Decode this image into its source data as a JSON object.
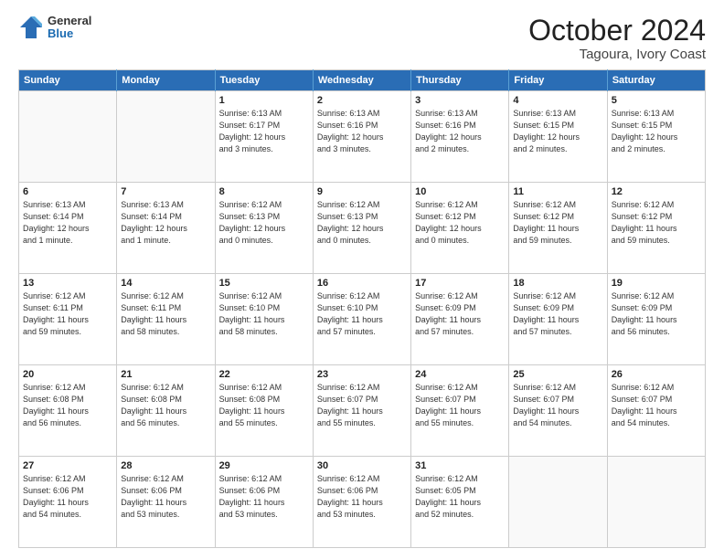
{
  "logo": {
    "line1": "General",
    "line2": "Blue"
  },
  "title": "October 2024",
  "subtitle": "Tagoura, Ivory Coast",
  "weekdays": [
    "Sunday",
    "Monday",
    "Tuesday",
    "Wednesday",
    "Thursday",
    "Friday",
    "Saturday"
  ],
  "weeks": [
    [
      {
        "day": "",
        "info": ""
      },
      {
        "day": "",
        "info": ""
      },
      {
        "day": "1",
        "info": "Sunrise: 6:13 AM\nSunset: 6:17 PM\nDaylight: 12 hours\nand 3 minutes."
      },
      {
        "day": "2",
        "info": "Sunrise: 6:13 AM\nSunset: 6:16 PM\nDaylight: 12 hours\nand 3 minutes."
      },
      {
        "day": "3",
        "info": "Sunrise: 6:13 AM\nSunset: 6:16 PM\nDaylight: 12 hours\nand 2 minutes."
      },
      {
        "day": "4",
        "info": "Sunrise: 6:13 AM\nSunset: 6:15 PM\nDaylight: 12 hours\nand 2 minutes."
      },
      {
        "day": "5",
        "info": "Sunrise: 6:13 AM\nSunset: 6:15 PM\nDaylight: 12 hours\nand 2 minutes."
      }
    ],
    [
      {
        "day": "6",
        "info": "Sunrise: 6:13 AM\nSunset: 6:14 PM\nDaylight: 12 hours\nand 1 minute."
      },
      {
        "day": "7",
        "info": "Sunrise: 6:13 AM\nSunset: 6:14 PM\nDaylight: 12 hours\nand 1 minute."
      },
      {
        "day": "8",
        "info": "Sunrise: 6:12 AM\nSunset: 6:13 PM\nDaylight: 12 hours\nand 0 minutes."
      },
      {
        "day": "9",
        "info": "Sunrise: 6:12 AM\nSunset: 6:13 PM\nDaylight: 12 hours\nand 0 minutes."
      },
      {
        "day": "10",
        "info": "Sunrise: 6:12 AM\nSunset: 6:12 PM\nDaylight: 12 hours\nand 0 minutes."
      },
      {
        "day": "11",
        "info": "Sunrise: 6:12 AM\nSunset: 6:12 PM\nDaylight: 11 hours\nand 59 minutes."
      },
      {
        "day": "12",
        "info": "Sunrise: 6:12 AM\nSunset: 6:12 PM\nDaylight: 11 hours\nand 59 minutes."
      }
    ],
    [
      {
        "day": "13",
        "info": "Sunrise: 6:12 AM\nSunset: 6:11 PM\nDaylight: 11 hours\nand 59 minutes."
      },
      {
        "day": "14",
        "info": "Sunrise: 6:12 AM\nSunset: 6:11 PM\nDaylight: 11 hours\nand 58 minutes."
      },
      {
        "day": "15",
        "info": "Sunrise: 6:12 AM\nSunset: 6:10 PM\nDaylight: 11 hours\nand 58 minutes."
      },
      {
        "day": "16",
        "info": "Sunrise: 6:12 AM\nSunset: 6:10 PM\nDaylight: 11 hours\nand 57 minutes."
      },
      {
        "day": "17",
        "info": "Sunrise: 6:12 AM\nSunset: 6:09 PM\nDaylight: 11 hours\nand 57 minutes."
      },
      {
        "day": "18",
        "info": "Sunrise: 6:12 AM\nSunset: 6:09 PM\nDaylight: 11 hours\nand 57 minutes."
      },
      {
        "day": "19",
        "info": "Sunrise: 6:12 AM\nSunset: 6:09 PM\nDaylight: 11 hours\nand 56 minutes."
      }
    ],
    [
      {
        "day": "20",
        "info": "Sunrise: 6:12 AM\nSunset: 6:08 PM\nDaylight: 11 hours\nand 56 minutes."
      },
      {
        "day": "21",
        "info": "Sunrise: 6:12 AM\nSunset: 6:08 PM\nDaylight: 11 hours\nand 56 minutes."
      },
      {
        "day": "22",
        "info": "Sunrise: 6:12 AM\nSunset: 6:08 PM\nDaylight: 11 hours\nand 55 minutes."
      },
      {
        "day": "23",
        "info": "Sunrise: 6:12 AM\nSunset: 6:07 PM\nDaylight: 11 hours\nand 55 minutes."
      },
      {
        "day": "24",
        "info": "Sunrise: 6:12 AM\nSunset: 6:07 PM\nDaylight: 11 hours\nand 55 minutes."
      },
      {
        "day": "25",
        "info": "Sunrise: 6:12 AM\nSunset: 6:07 PM\nDaylight: 11 hours\nand 54 minutes."
      },
      {
        "day": "26",
        "info": "Sunrise: 6:12 AM\nSunset: 6:07 PM\nDaylight: 11 hours\nand 54 minutes."
      }
    ],
    [
      {
        "day": "27",
        "info": "Sunrise: 6:12 AM\nSunset: 6:06 PM\nDaylight: 11 hours\nand 54 minutes."
      },
      {
        "day": "28",
        "info": "Sunrise: 6:12 AM\nSunset: 6:06 PM\nDaylight: 11 hours\nand 53 minutes."
      },
      {
        "day": "29",
        "info": "Sunrise: 6:12 AM\nSunset: 6:06 PM\nDaylight: 11 hours\nand 53 minutes."
      },
      {
        "day": "30",
        "info": "Sunrise: 6:12 AM\nSunset: 6:06 PM\nDaylight: 11 hours\nand 53 minutes."
      },
      {
        "day": "31",
        "info": "Sunrise: 6:12 AM\nSunset: 6:05 PM\nDaylight: 11 hours\nand 52 minutes."
      },
      {
        "day": "",
        "info": ""
      },
      {
        "day": "",
        "info": ""
      }
    ]
  ]
}
